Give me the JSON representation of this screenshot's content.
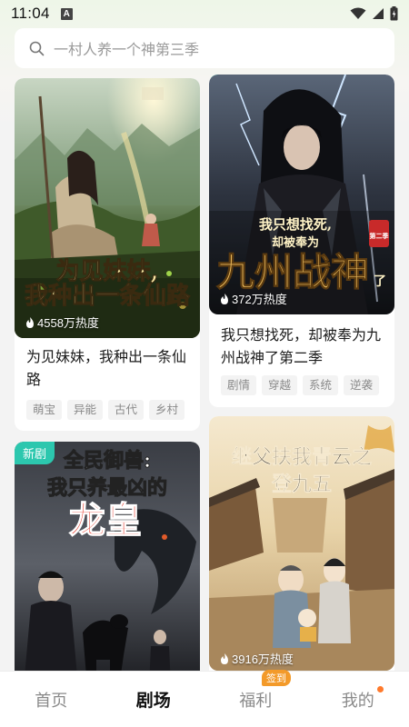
{
  "status_bar": {
    "time": "11:04",
    "notification_letter": "A"
  },
  "search": {
    "placeholder": "一村人养一个神第三季"
  },
  "cards": [
    {
      "cover_title_line1": "为见妹妹,",
      "cover_title_line2": "我种出一条仙路",
      "heat": "4558万热度",
      "title": "为见妹妹，我种出一条仙路",
      "tags": [
        "萌宝",
        "异能",
        "古代",
        "乡村"
      ]
    },
    {
      "cover_title_small1": "我只想找死,",
      "cover_title_small2": "却被奉为",
      "cover_title_big": "九州战神",
      "cover_title_tail": "了",
      "cover_seal": "第二季",
      "heat": "372万热度",
      "title": "我只想找死，却被奉为九州战神了第二季",
      "tags": [
        "剧情",
        "穿越",
        "系统",
        "逆袭"
      ]
    },
    {
      "badge": "新剧",
      "cover_title_line1": "全民御兽:",
      "cover_title_line2": "我只养最凶的",
      "cover_title_big": "龙皇"
    },
    {
      "cover_title_line1": "继父扶我青云之",
      "cover_title_line2": "登九五",
      "heat": "3916万热度"
    }
  ],
  "bottom_nav": {
    "items": [
      {
        "label": "首页"
      },
      {
        "label": "剧场"
      },
      {
        "label": "福利",
        "badge": "签到"
      },
      {
        "label": "我的"
      }
    ]
  },
  "colors": {
    "accent_teal": "#2cc7ae",
    "badge_orange": "#f39a2a",
    "dot_orange": "#ff7a2c"
  }
}
